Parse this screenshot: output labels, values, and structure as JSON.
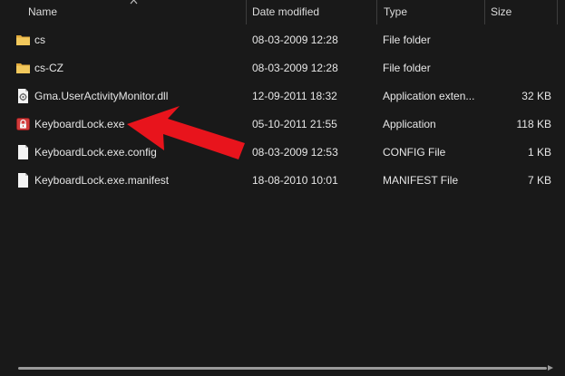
{
  "columns": {
    "name": "Name",
    "date": "Date modified",
    "type": "Type",
    "size": "Size"
  },
  "files": [
    {
      "name": "cs",
      "date": "08-03-2009 12:28",
      "type": "File folder",
      "size": "",
      "icon": "folder-icon"
    },
    {
      "name": "cs-CZ",
      "date": "08-03-2009 12:28",
      "type": "File folder",
      "size": "",
      "icon": "folder-icon"
    },
    {
      "name": "Gma.UserActivityMonitor.dll",
      "date": "12-09-2011 18:32",
      "type": "Application exten...",
      "size": "32 KB",
      "icon": "dll-file-icon"
    },
    {
      "name": "KeyboardLock.exe",
      "date": "05-10-2011 21:55",
      "type": "Application",
      "size": "118 KB",
      "icon": "lock-app-icon"
    },
    {
      "name": "KeyboardLock.exe.config",
      "date": "08-03-2009 12:53",
      "type": "CONFIG File",
      "size": "1 KB",
      "icon": "document-icon"
    },
    {
      "name": "KeyboardLock.exe.manifest",
      "date": "18-08-2010 10:01",
      "type": "MANIFEST File",
      "size": "7 KB",
      "icon": "document-icon"
    }
  ],
  "colors": {
    "background": "#191919",
    "folder": "#e8b84a",
    "annotation_arrow": "#e8141c",
    "lock_app": "#d23a3a"
  },
  "annotation": {
    "icon": "red-pointer-arrow-icon"
  }
}
